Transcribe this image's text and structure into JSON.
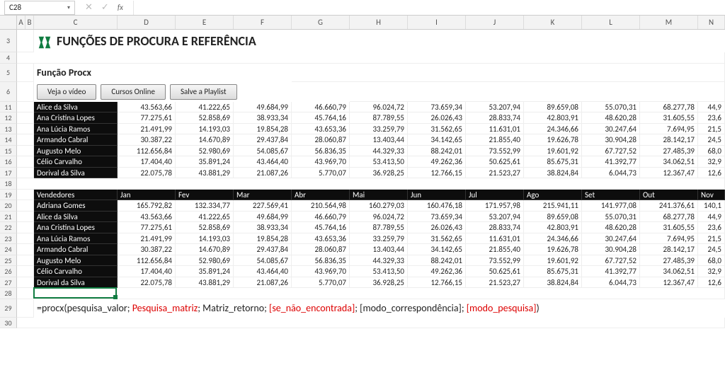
{
  "nameBox": "C28",
  "columns": [
    "A",
    "B",
    "C",
    "D",
    "E",
    "F",
    "G",
    "H",
    "I",
    "J",
    "K",
    "L",
    "M",
    "N"
  ],
  "colWidths": {
    "A": 12,
    "B": 12,
    "C": 118,
    "D": 82,
    "E": 82,
    "F": 82,
    "G": 82,
    "H": 82,
    "I": 82,
    "J": 82,
    "K": 82,
    "L": 82,
    "M": 82,
    "N": 38
  },
  "title": "FUNÇÕES DE PROCURA E REFERÊNCIA",
  "subtitle": "Função Procx",
  "buttons": {
    "video": "Veja o vídeo",
    "cursos": "Cursos Online",
    "playlist": "Salve a Playlist"
  },
  "table1": {
    "rows": [
      {
        "name": "Alice da Silva",
        "v": [
          "43.563,66",
          "41.222,65",
          "49.684,99",
          "46.660,79",
          "96.024,72",
          "73.659,34",
          "53.207,94",
          "89.659,08",
          "55.070,31",
          "68.277,78",
          "44,9"
        ]
      },
      {
        "name": "Ana Cristina Lopes",
        "v": [
          "77.275,61",
          "52.858,69",
          "38.933,34",
          "45.764,16",
          "87.789,55",
          "26.026,43",
          "28.833,74",
          "42.803,91",
          "48.620,28",
          "31.605,55",
          "23,6"
        ]
      },
      {
        "name": "Ana Lúcia Ramos",
        "v": [
          "21.491,99",
          "14.193,03",
          "19.854,28",
          "43.653,36",
          "33.259,79",
          "31.562,65",
          "11.631,01",
          "24.346,66",
          "30.247,64",
          "7.694,95",
          "21,5"
        ]
      },
      {
        "name": "Armando Cabral",
        "v": [
          "30.387,22",
          "14.670,89",
          "29.437,84",
          "28.060,87",
          "13.403,44",
          "34.142,65",
          "21.855,40",
          "19.626,78",
          "30.904,28",
          "28.142,17",
          "24,5"
        ]
      },
      {
        "name": "Augusto Melo",
        "v": [
          "112.656,84",
          "52.980,69",
          "54.085,67",
          "56.836,35",
          "44.329,33",
          "88.242,01",
          "73.552,99",
          "19.601,92",
          "67.727,52",
          "27.485,39",
          "68,0"
        ]
      },
      {
        "name": "Célio Carvalho",
        "v": [
          "17.404,40",
          "35.891,24",
          "43.464,40",
          "43.969,70",
          "53.413,50",
          "49.262,36",
          "50.625,61",
          "85.675,31",
          "41.392,77",
          "34.062,51",
          "32,9"
        ]
      },
      {
        "name": "Dorival da Silva",
        "v": [
          "22.075,78",
          "43.881,29",
          "21.087,26",
          "5.770,07",
          "36.928,25",
          "12.766,15",
          "21.523,27",
          "38.824,84",
          "6.044,73",
          "12.367,47",
          "12,6"
        ]
      }
    ]
  },
  "table2": {
    "header": [
      "Vendedores",
      "Jan",
      "Fev",
      "Mar",
      "Abr",
      "Mai",
      "Jun",
      "Jul",
      "Ago",
      "Set",
      "Out",
      "Nov"
    ],
    "rows": [
      {
        "name": "Adriana Gomes",
        "v": [
          "165.792,82",
          "132.334,77",
          "227.569,41",
          "210.564,98",
          "160.279,03",
          "160.476,18",
          "171.957,98",
          "215.941,11",
          "141.977,08",
          "241.376,61",
          "140,1"
        ]
      },
      {
        "name": "Alice da Silva",
        "v": [
          "43.563,66",
          "41.222,65",
          "49.684,99",
          "46.660,79",
          "96.024,72",
          "73.659,34",
          "53.207,94",
          "89.659,08",
          "55.070,31",
          "68.277,78",
          "44,9"
        ]
      },
      {
        "name": "Ana Cristina Lopes",
        "v": [
          "77.275,61",
          "52.858,69",
          "38.933,34",
          "45.764,16",
          "87.789,55",
          "26.026,43",
          "28.833,74",
          "42.803,91",
          "48.620,28",
          "31.605,55",
          "23,6"
        ]
      },
      {
        "name": "Ana Lúcia Ramos",
        "v": [
          "21.491,99",
          "14.193,03",
          "19.854,28",
          "43.653,36",
          "33.259,79",
          "31.562,65",
          "11.631,01",
          "24.346,66",
          "30.247,64",
          "7.694,95",
          "21,5"
        ]
      },
      {
        "name": "Armando Cabral",
        "v": [
          "30.387,22",
          "14.670,89",
          "29.437,84",
          "28.060,87",
          "13.403,44",
          "34.142,65",
          "21.855,40",
          "19.626,78",
          "30.904,28",
          "28.142,17",
          "24,5"
        ]
      },
      {
        "name": "Augusto Melo",
        "v": [
          "112.656,84",
          "52.980,69",
          "54.085,67",
          "56.836,35",
          "44.329,33",
          "88.242,01",
          "73.552,99",
          "19.601,92",
          "67.727,52",
          "27.485,39",
          "68,0"
        ]
      },
      {
        "name": "Célio Carvalho",
        "v": [
          "17.404,40",
          "35.891,24",
          "43.464,40",
          "43.969,70",
          "53.413,50",
          "49.262,36",
          "50.625,61",
          "85.675,31",
          "41.392,77",
          "34.062,51",
          "32,9"
        ]
      },
      {
        "name": "Dorival da Silva",
        "v": [
          "22.075,78",
          "43.881,29",
          "21.087,26",
          "5.770,07",
          "36.928,25",
          "12.766,15",
          "21.523,27",
          "38.824,84",
          "6.044,73",
          "12.367,47",
          "12,6"
        ]
      }
    ]
  },
  "formulaParts": [
    {
      "t": "=procx(pesquisa_valor; ",
      "c": "black"
    },
    {
      "t": "Pesquisa_matriz",
      "c": "red"
    },
    {
      "t": "; Matriz_retorno; ",
      "c": "black"
    },
    {
      "t": "[se_não_encontrada]",
      "c": "red"
    },
    {
      "t": "; [modo_correspondência]; ",
      "c": "black"
    },
    {
      "t": "[modo_pesquisa]",
      "c": "red"
    },
    {
      "t": ")",
      "c": "black"
    }
  ],
  "rowNums": [
    3,
    4,
    5,
    6,
    11,
    12,
    13,
    14,
    15,
    16,
    17,
    18,
    19,
    20,
    21,
    22,
    23,
    24,
    25,
    26,
    27,
    28,
    29,
    30
  ]
}
